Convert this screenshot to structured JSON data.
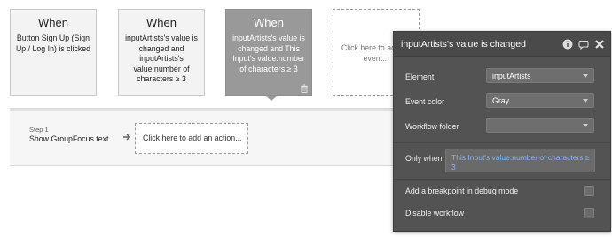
{
  "events": [
    {
      "when": "When",
      "description": "Button Sign Up (Sign Up / Log In) is clicked"
    },
    {
      "when": "When",
      "description": "inputArtists's value is changed and inputArtists's value:number of characters ≥ 3"
    },
    {
      "when": "When",
      "description": "inputArtists's value is changed and This Input's value:number of characters ≥ 3",
      "selected": true
    },
    {
      "add_text": "Click here to add an event..."
    }
  ],
  "workflow": {
    "step_label": "Step 1",
    "step_text": "Show GroupFocus text",
    "add_action": "Click here to add an action..."
  },
  "panel": {
    "title": "inputArtists's value is changed",
    "element_label": "Element",
    "element_value": "inputArtists",
    "color_label": "Event color",
    "color_value": "Gray",
    "folder_label": "Workflow folder",
    "folder_value": "",
    "only_when_label": "Only when",
    "only_when_value": "This Input's value:number of characters ≥ 3",
    "breakpoint_label": "Add a breakpoint in debug mode",
    "disable_label": "Disable workflow",
    "icons": [
      "info-icon",
      "comment-icon",
      "close-icon"
    ]
  },
  "colors": {
    "selected_event": "#999999",
    "panel_bg": "#535353",
    "condition_text": "#8ab4ec"
  }
}
